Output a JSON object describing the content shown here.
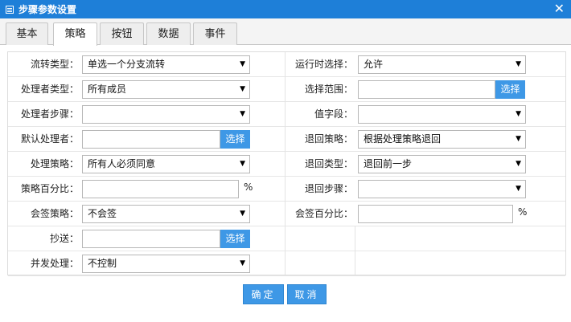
{
  "window": {
    "title": "步骤参数设置",
    "close_glyph": "✕"
  },
  "tabs": [
    {
      "label": "基本",
      "active": false
    },
    {
      "label": "策略",
      "active": true
    },
    {
      "label": "按钮",
      "active": false
    },
    {
      "label": "数据",
      "active": false
    },
    {
      "label": "事件",
      "active": false
    }
  ],
  "form": {
    "flow_type": {
      "label": "流转类型：",
      "value": "单选一个分支流转"
    },
    "runtime_select": {
      "label": "运行时选择：",
      "value": "允许"
    },
    "handler_type": {
      "label": "处理者类型：",
      "value": "所有成员"
    },
    "select_range": {
      "label": "选择范围：",
      "value": "",
      "button": "选择"
    },
    "handler_step": {
      "label": "处理者步骤：",
      "value": ""
    },
    "value_field": {
      "label": "值字段：",
      "value": ""
    },
    "default_handler": {
      "label": "默认处理者：",
      "value": "",
      "button": "选择"
    },
    "return_policy": {
      "label": "退回策略：",
      "value": "根据处理策略退回"
    },
    "handle_policy": {
      "label": "处理策略：",
      "value": "所有人必须同意"
    },
    "return_type": {
      "label": "退回类型：",
      "value": "退回前一步"
    },
    "policy_percent": {
      "label": "策略百分比：",
      "value": "",
      "unit": "%"
    },
    "return_step": {
      "label": "退回步骤：",
      "value": ""
    },
    "countersign_policy": {
      "label": "会签策略：",
      "value": "不会签"
    },
    "countersign_percent": {
      "label": "会签百分比：",
      "value": "",
      "unit": "%"
    },
    "cc": {
      "label": "抄送：",
      "value": "",
      "button": "选择"
    },
    "concurrent": {
      "label": "并发处理：",
      "value": "不控制"
    }
  },
  "actions": {
    "ok": "确定",
    "cancel": "取消"
  },
  "icons": {
    "dropdown": "▼",
    "window": "list-icon"
  },
  "colors": {
    "titlebar": "#1e7fd8",
    "button": "#3e98e6"
  }
}
